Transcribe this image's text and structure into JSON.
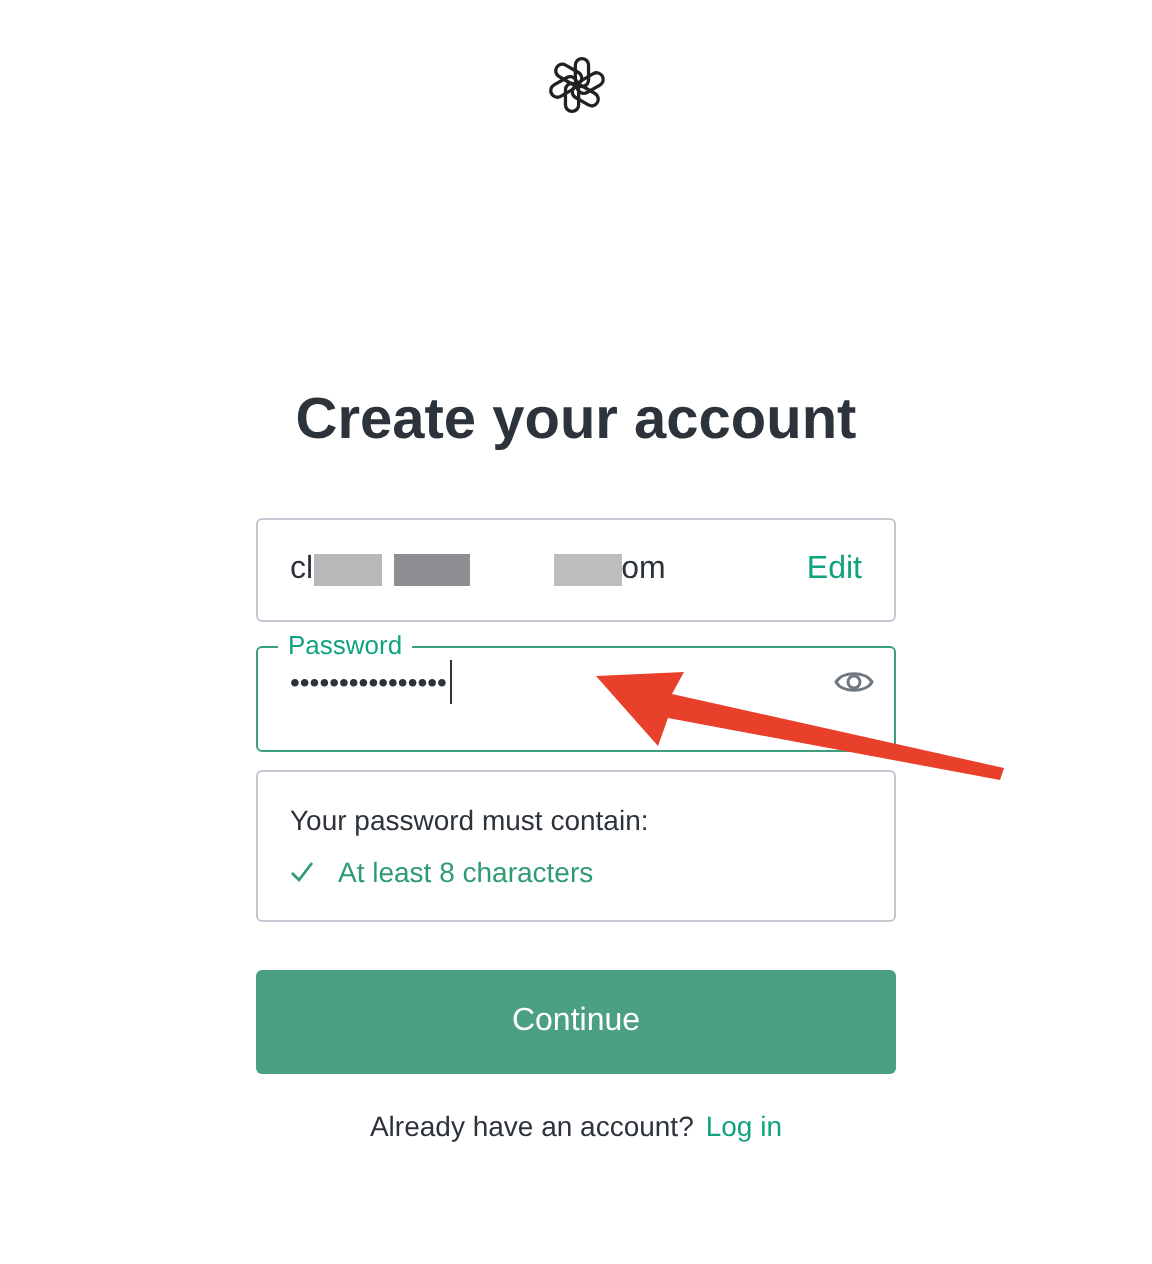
{
  "title": "Create your account",
  "email": {
    "visible_start": "cl",
    "visible_end": "om",
    "redacted": true,
    "action": "Edit"
  },
  "password": {
    "label": "Password",
    "value": "••••••••••••••••",
    "focused": true
  },
  "requirements": {
    "heading": "Your password must contain:",
    "items": [
      {
        "text": "At least 8 characters",
        "met": true
      }
    ]
  },
  "continue_button": "Continue",
  "footer": {
    "text": "Already have an account?",
    "link": "Log in"
  },
  "annotation": {
    "kind": "arrow"
  }
}
